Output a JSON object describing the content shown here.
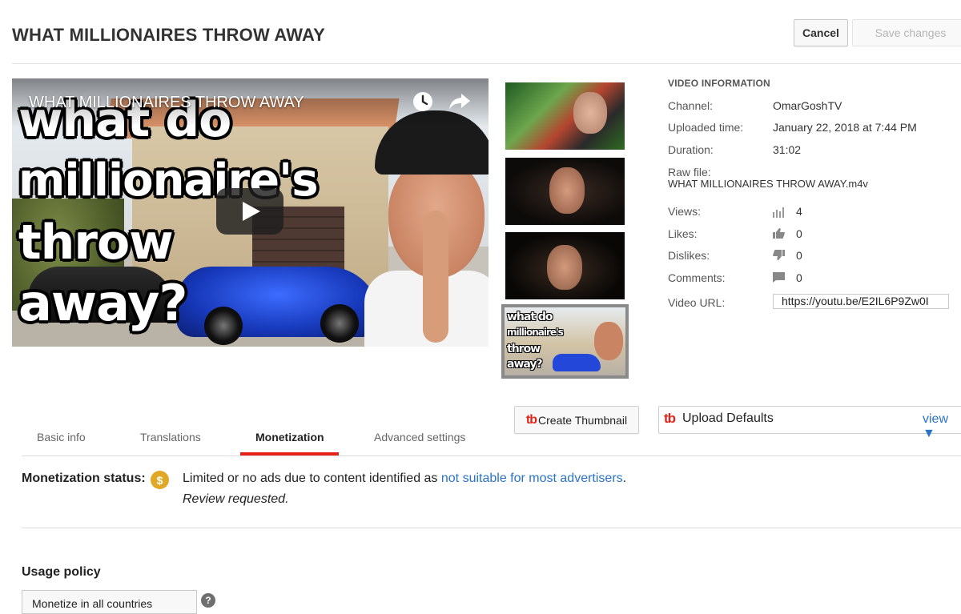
{
  "header": {
    "title": "WHAT MILLIONAIRES THROW AWAY",
    "cancel_label": "Cancel",
    "save_label": "Save changes"
  },
  "player": {
    "overlay_title": "WHAT MILLIONAIRES THROW AWAY",
    "thumbnail_text": [
      "what do",
      "millionaire's",
      "throw",
      "away?"
    ],
    "icons": [
      "clock-icon",
      "share-icon",
      "play-icon"
    ]
  },
  "video_info": {
    "heading": "VIDEO INFORMATION",
    "channel_label": "Channel:",
    "channel_value": "OmarGoshTV",
    "uploaded_label": "Uploaded time:",
    "uploaded_value": "January 22, 2018 at 7:44 PM",
    "duration_label": "Duration:",
    "duration_value": "31:02",
    "raw_file_label": "Raw file:",
    "raw_file_value": "WHAT MILLIONAIRES THROW AWAY.m4v",
    "views_label": "Views:",
    "views_value": "4",
    "likes_label": "Likes:",
    "likes_value": "0",
    "dislikes_label": "Dislikes:",
    "dislikes_value": "0",
    "comments_label": "Comments:",
    "comments_value": "0",
    "url_label": "Video URL:",
    "url_value": "https://youtu.be/E2IL6P9Zw0I"
  },
  "toolbar": {
    "tb_logo": "tb",
    "create_thumbnail_label": "Create Thumbnail",
    "upload_defaults_label": "Upload Defaults",
    "view_label": "view ▼"
  },
  "tabs": [
    {
      "label": "Basic info"
    },
    {
      "label": "Translations"
    },
    {
      "label": "Monetization"
    },
    {
      "label": "Advanced settings"
    }
  ],
  "monetization": {
    "status_label": "Monetization status:",
    "dollar_symbol": "$",
    "status_text_prefix": "Limited or no ads due to content identified as ",
    "status_link": "not suitable for most advertisers",
    "status_text_suffix": ".",
    "review_text": "Review requested."
  },
  "usage_policy": {
    "title": "Usage policy",
    "select_value": "Monetize in all countries",
    "help_symbol": "?"
  },
  "colors": {
    "accent_red": "#e62117",
    "link_blue": "#2a73c6",
    "dollar_gold": "#e1a826",
    "tb_red": "#e0231a"
  }
}
